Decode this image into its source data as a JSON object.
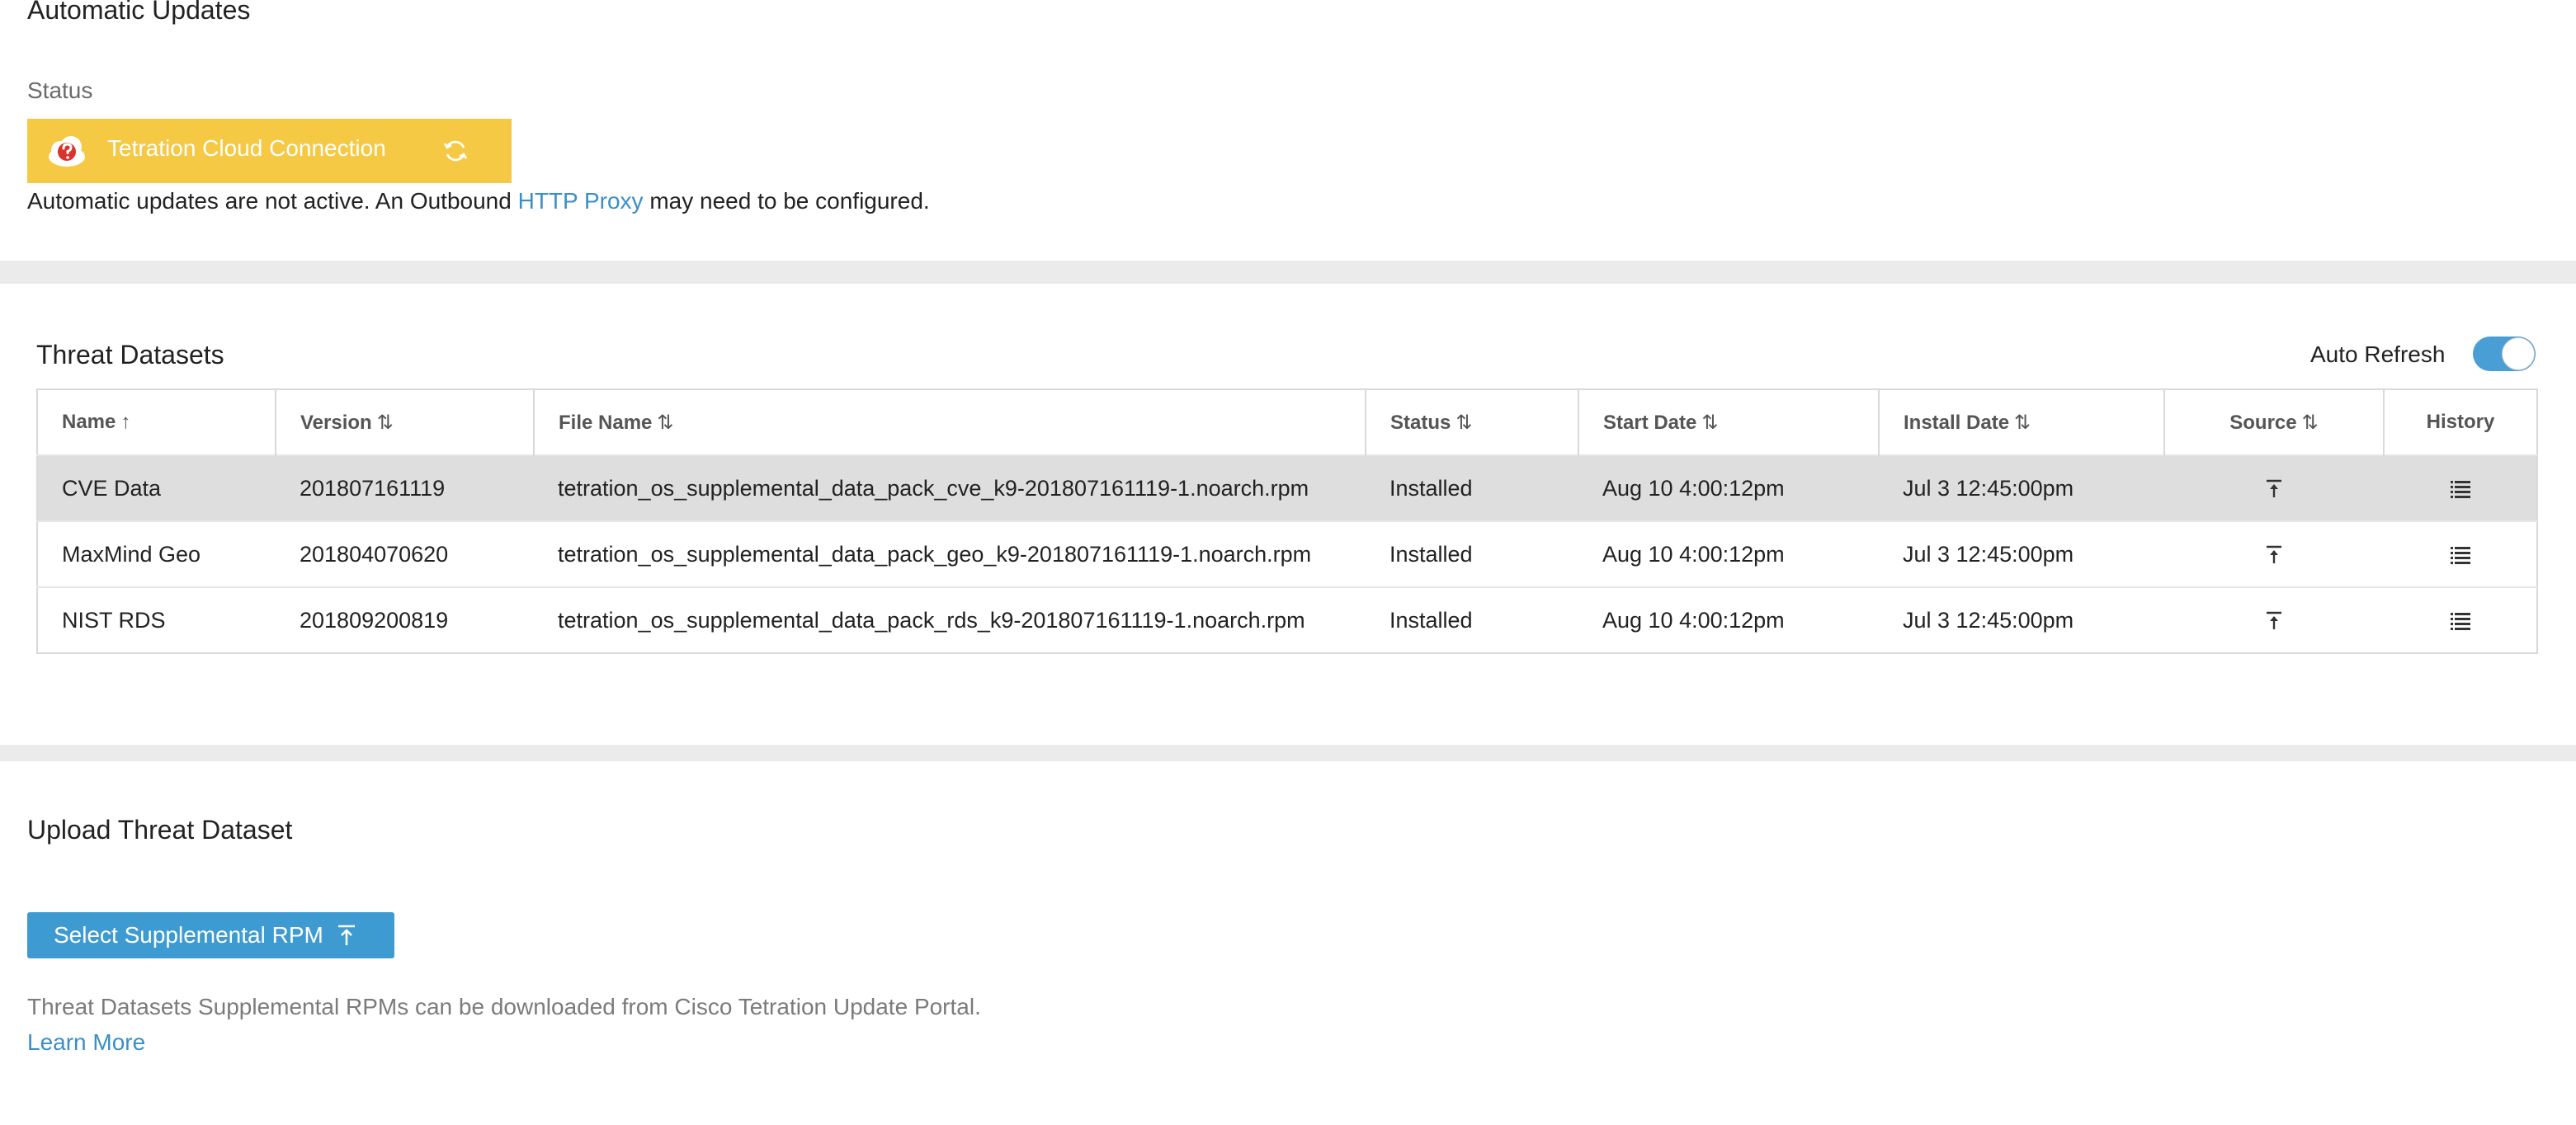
{
  "automatic_updates": {
    "title": "Automatic Updates",
    "status_label": "Status",
    "connection": {
      "label": "Tetration Cloud Connection",
      "icon": "cloud-question-icon",
      "color": "#f6c944"
    },
    "message_before": "Automatic updates are not active. An Outbound ",
    "message_link": "HTTP Proxy",
    "message_after": " may need to be configured."
  },
  "threat_datasets": {
    "title": "Threat Datasets",
    "auto_refresh_label": "Auto Refresh",
    "auto_refresh_on": true,
    "columns": {
      "name": "Name",
      "version": "Version",
      "file_name": "File Name",
      "status": "Status",
      "start_date": "Start Date",
      "install_date": "Install Date",
      "source": "Source",
      "history": "History"
    },
    "rows": [
      {
        "name": "CVE Data",
        "version": "201807161119",
        "file_name": "tetration_os_supplemental_data_pack_cve_k9-201807161119-1.noarch.rpm",
        "status": "Installed",
        "start_date": "Aug 10 4:00:12pm",
        "install_date": "Jul 3 12:45:00pm"
      },
      {
        "name": "MaxMind Geo",
        "version": "201804070620",
        "file_name": "tetration_os_supplemental_data_pack_geo_k9-201807161119-1.noarch.rpm",
        "status": "Installed",
        "start_date": "Aug 10 4:00:12pm",
        "install_date": "Jul 3 12:45:00pm"
      },
      {
        "name": "NIST RDS",
        "version": "201809200819",
        "file_name": "tetration_os_supplemental_data_pack_rds_k9-201807161119-1.noarch.rpm",
        "status": "Installed",
        "start_date": "Aug 10 4:00:12pm",
        "install_date": "Jul 3 12:45:00pm"
      }
    ]
  },
  "upload": {
    "title": "Upload Threat Dataset",
    "button_label": "Select Supplemental RPM",
    "note": "Threat Datasets Supplemental RPMs can be downloaded from Cisco Tetration Update Portal.",
    "learn_more": "Learn More"
  },
  "colors": {
    "accent": "#3d9bd2",
    "link": "#3a8fc6",
    "warning": "#f6c944"
  }
}
